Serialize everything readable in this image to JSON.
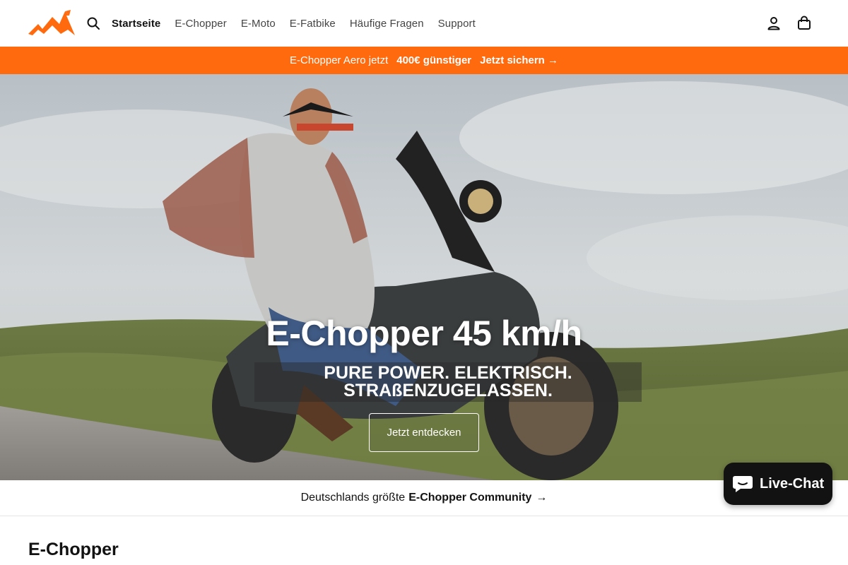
{
  "header": {
    "logo_name": "brand-logo",
    "nav": [
      {
        "label": "Startseite",
        "active": true
      },
      {
        "label": "E-Chopper",
        "active": false
      },
      {
        "label": "E-Moto",
        "active": false
      },
      {
        "label": "E-Fatbike",
        "active": false
      },
      {
        "label": "Häufige Fragen",
        "active": false
      },
      {
        "label": "Support",
        "active": false
      }
    ],
    "icons": [
      "search-icon",
      "account-icon",
      "cart-icon"
    ]
  },
  "announcement": {
    "text": "E-Chopper Aero jetzt",
    "highlight": "400€ günstiger",
    "link": "Jetzt sichern →",
    "bg_color": "#ff6a0e"
  },
  "hero": {
    "title": "E-Chopper 45 km/h",
    "subtitle_line1": "PURE POWER. ELEKTRISCH.",
    "subtitle_line2": "STRAßENZUGELASSEN.",
    "button": "Jetzt entdecken"
  },
  "community": {
    "prefix": "Deutschlands größte",
    "bold": "E-Chopper Community",
    "arrow": "→"
  },
  "section": {
    "title": "E-Chopper"
  },
  "livechat": {
    "label": "Live-Chat"
  }
}
